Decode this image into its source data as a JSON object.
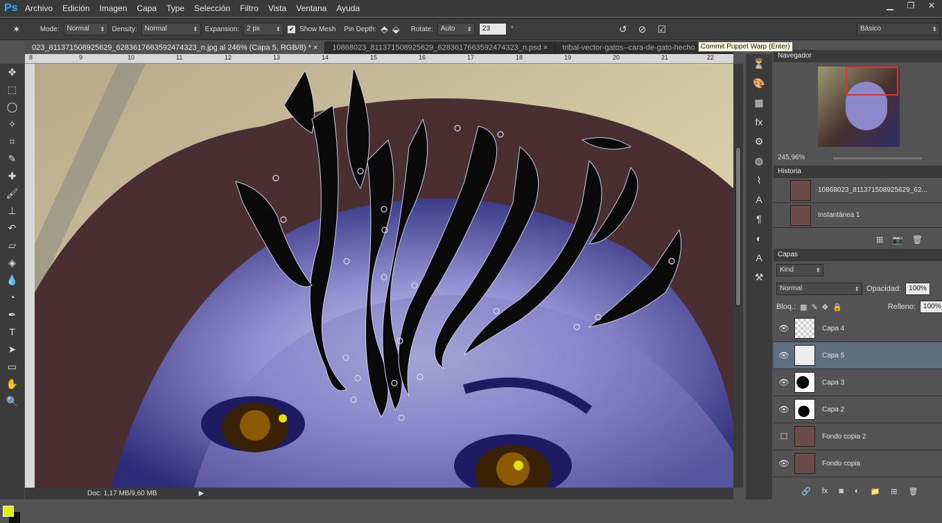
{
  "menubar": {
    "logo": "Ps",
    "items": [
      "Archivo",
      "Edición",
      "Imagen",
      "Capa",
      "Type",
      "Selección",
      "Filtro",
      "Vista",
      "Ventana",
      "Ayuda"
    ]
  },
  "options": {
    "mode_label": "Mode:",
    "mode_value": "Normal",
    "density_label": "Density:",
    "density_value": "Normal",
    "expansion_label": "Expansion:",
    "expansion_value": "2 px",
    "show_mesh_label": "Show Mesh",
    "pin_depth_label": "Pin Depth:",
    "rotate_label": "Rotate:",
    "rotate_mode": "Auto",
    "rotate_value": "23",
    "degree_symbol": "°",
    "workspace": "Básico",
    "show_mesh_checked": true
  },
  "tooltip": "Commit Puppet Warp (Enter)",
  "tabs": [
    "023_811371508925629_6283617663592474323_n.jpg al 246% (Capa 5, RGB/8) *",
    "10868023_811371508925629_6283617663592474323_n.psd",
    "tribal-vector-gatos--cara-de-gato-hecho"
  ],
  "ruler": [
    "8",
    "9",
    "10",
    "11",
    "12",
    "13",
    "14",
    "15",
    "16",
    "17",
    "18",
    "19",
    "20",
    "21",
    "22"
  ],
  "statusbar": {
    "doc": "Doc: 1,17 MB/9,60 MB"
  },
  "navigator": {
    "title": "Navegador",
    "zoom": "245,96%"
  },
  "history": {
    "title": "Historia",
    "items": [
      "10868023_811371508925629_62...",
      "Instantánea 1"
    ]
  },
  "layers": {
    "title": "Capas",
    "kind": "Kind",
    "blend_mode": "Normal",
    "opacity_label": "Opacidad:",
    "opacity_value": "100%",
    "lock_label": "Bloq.:",
    "fill_label": "Relleno:",
    "fill_value": "100%",
    "items": [
      {
        "name": "Capa 4",
        "visible": true,
        "selected": false
      },
      {
        "name": "Capa 5",
        "visible": true,
        "selected": true
      },
      {
        "name": "Capa 3",
        "visible": true,
        "selected": false
      },
      {
        "name": "Capa 2",
        "visible": true,
        "selected": false
      },
      {
        "name": "Fondo copia 2",
        "visible": false,
        "selected": false
      },
      {
        "name": "Fondo copia",
        "visible": true,
        "selected": false
      }
    ]
  },
  "colors": {
    "foreground": "#e0f000",
    "background": "#111111",
    "accent": "#31a8ff"
  }
}
